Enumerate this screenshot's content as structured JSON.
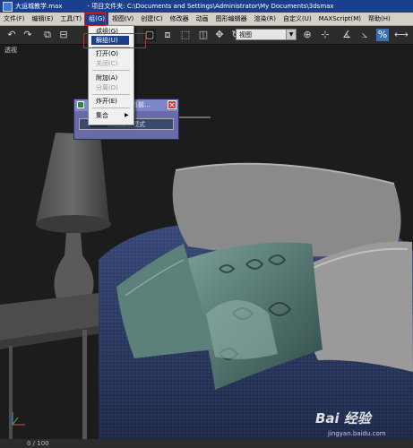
{
  "window": {
    "title": "大运城教学.max",
    "project_path": "- 项目文件夹: C:\\Documents and Settings\\Administrator\\My Documents\\3dsmax"
  },
  "menubar": {
    "items": [
      "文件(F)",
      "编辑(E)",
      "工具(T)",
      "组(G)",
      "视图(V)",
      "创建(C)",
      "修改器",
      "动画",
      "图形编辑器",
      "渲染(R)",
      "自定义(U)",
      "MAXScript(M)",
      "帮助(H)"
    ],
    "active_index": 3
  },
  "toolbar": {
    "view_select": "视图",
    "icons": [
      "undo-icon",
      "redo-icon",
      "link-icon",
      "unlink-icon",
      "select-icon",
      "region-select-icon",
      "move-icon",
      "rotate-icon",
      "scale-icon",
      "snap-icon",
      "mirror-icon",
      "align-icon"
    ]
  },
  "group_menu": {
    "items": [
      {
        "label": "成组(G)",
        "enabled": true
      },
      {
        "label": "解组(U)",
        "enabled": true,
        "highlighted": true
      },
      {
        "label": "打开(O)",
        "enabled": true
      },
      {
        "label": "关闭(C)",
        "enabled": false
      },
      {
        "label": "附加(A)",
        "enabled": true
      },
      {
        "label": "分离(D)",
        "enabled": false
      },
      {
        "label": "炸开(E)",
        "enabled": true
      },
      {
        "label": "集合",
        "enabled": true,
        "submenu": true
      }
    ]
  },
  "floating_dialog": {
    "title": "当前...",
    "button": "退出孤立模式"
  },
  "viewport": {
    "label": "透视"
  },
  "statusbar": {
    "frame": "0 / 100"
  },
  "watermark": {
    "main": "Bai 经验",
    "sub": "jingyan.baidu.com"
  },
  "colors": {
    "title_bar": "#1a3f8d",
    "menu_bg": "#d4d0c8",
    "highlight": "#1a3f8d",
    "annotation_red": "#e02020",
    "viewport_bg": "#1c1c1c"
  }
}
